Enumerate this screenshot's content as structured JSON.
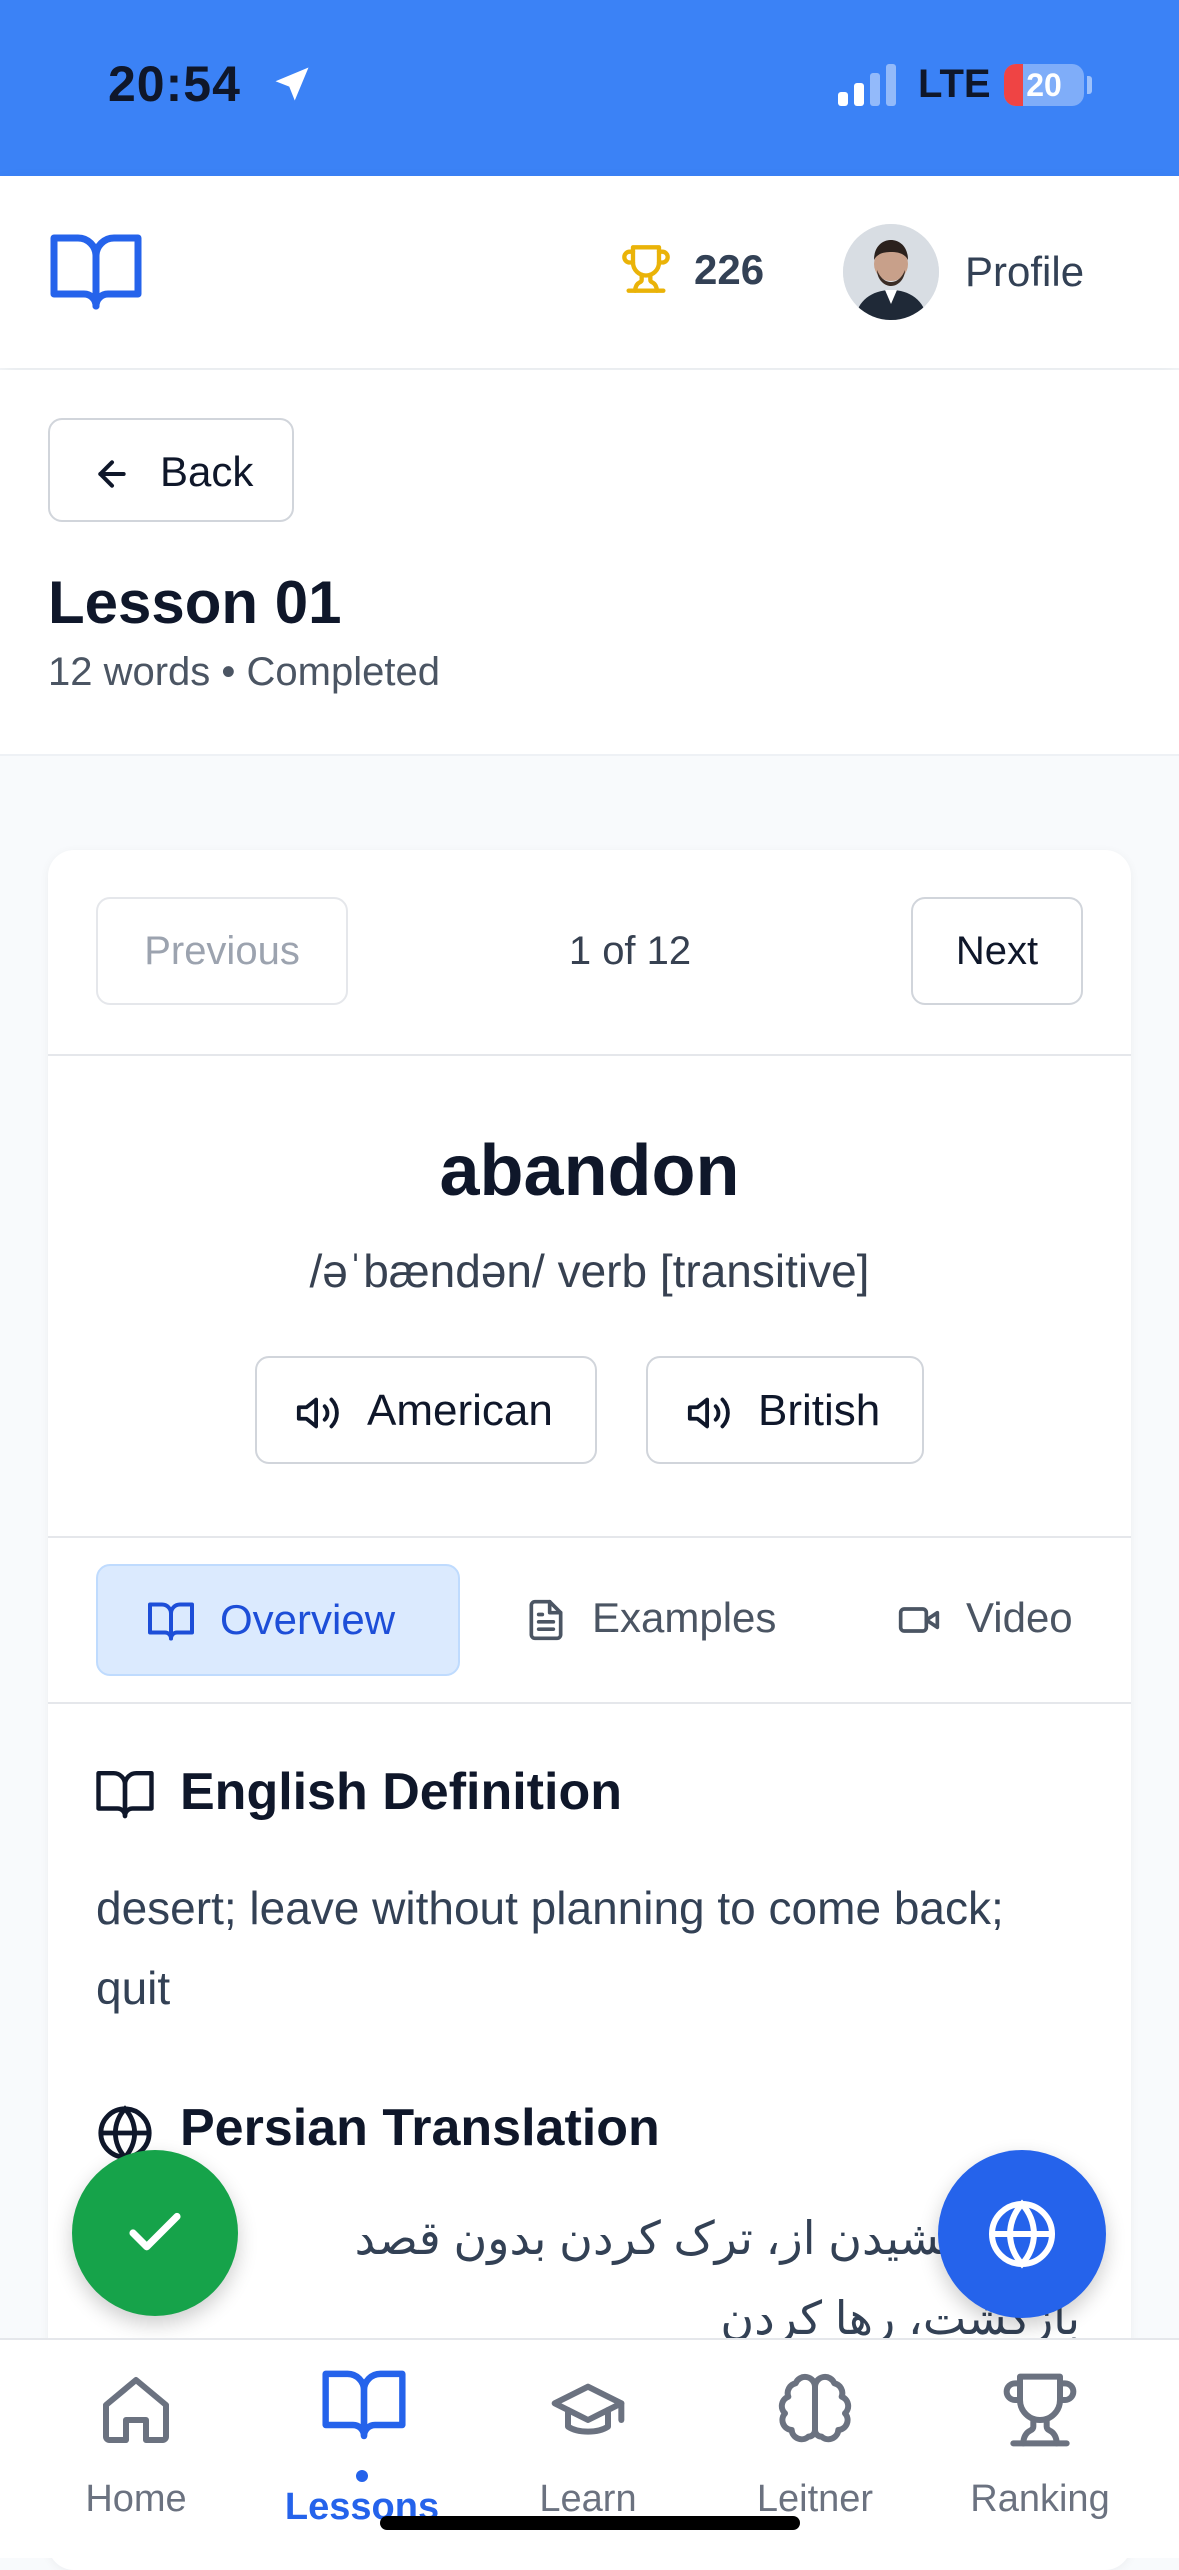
{
  "status_bar": {
    "time": "20:54",
    "network": "LTE",
    "battery": "20"
  },
  "header": {
    "points": "226",
    "profile_label": "Profile"
  },
  "lesson": {
    "back_label": "Back",
    "title": "Lesson 01",
    "meta": "12 words • Completed"
  },
  "word_nav": {
    "previous": "Previous",
    "counter": "1 of 12",
    "next": "Next"
  },
  "word": {
    "text": "abandon",
    "phonetic": "/əˈbændən/ verb [transitive]",
    "audio": {
      "american": "American",
      "british": "British"
    }
  },
  "tabs": {
    "overview": "Overview",
    "examples": "Examples",
    "video": "Video",
    "active": "Overview"
  },
  "overview": {
    "definition_title": "English Definition",
    "definition_text": "desert; leave without planning to come back; quit",
    "translation_title": "Persian Translation",
    "translation_text": "دست کشیدن از، ترک کردن بدون قصد بازگشت، رها کردن"
  },
  "bottom_nav": {
    "items": [
      {
        "label": "Home",
        "icon": "home-icon"
      },
      {
        "label": "Lessons",
        "icon": "book-icon",
        "active": true
      },
      {
        "label": "Learn",
        "icon": "graduation-cap-icon"
      },
      {
        "label": "Leitner",
        "icon": "brain-icon"
      },
      {
        "label": "Ranking",
        "icon": "trophy-icon"
      }
    ]
  },
  "colors": {
    "primary": "#2563eb",
    "status_bar": "#3b82f6",
    "success": "#16a34a",
    "trophy": "#eab308"
  }
}
